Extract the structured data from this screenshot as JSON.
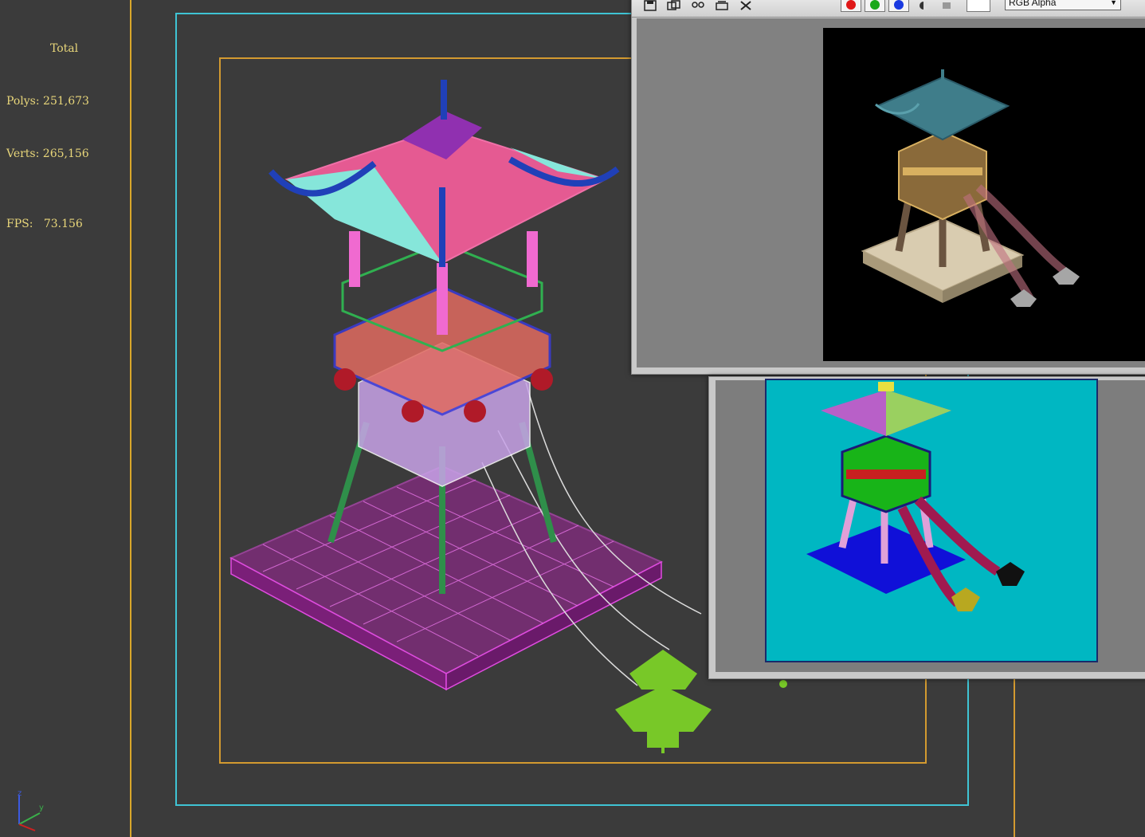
{
  "stats": {
    "total_label": "Total",
    "polys_label": "Polys:",
    "polys_value": "251,673",
    "verts_label": "Verts:",
    "verts_value": "265,156",
    "fps_label": "FPS:",
    "fps_value": "73.156"
  },
  "axis": {
    "z_label": "z",
    "y_label": "y"
  },
  "render_window": {
    "toolbar_icons": [
      "save-icon",
      "clone-icon",
      "print-icon",
      "copy-icon",
      "clear-icon"
    ],
    "channel_buttons": [
      {
        "name": "red-channel",
        "color": "#e01818"
      },
      {
        "name": "green-channel",
        "color": "#1aa81a"
      },
      {
        "name": "blue-channel",
        "color": "#1a3ae0"
      }
    ],
    "channel_select_value": "RGB Alpha"
  },
  "colors": {
    "viewport_bg": "#3b3b3b",
    "safe_frame_cyan": "#3fc4d4",
    "safe_frame_orange": "#d39a30",
    "stats_text": "#e8d67a",
    "id_render_bg": "#00b7c2"
  }
}
